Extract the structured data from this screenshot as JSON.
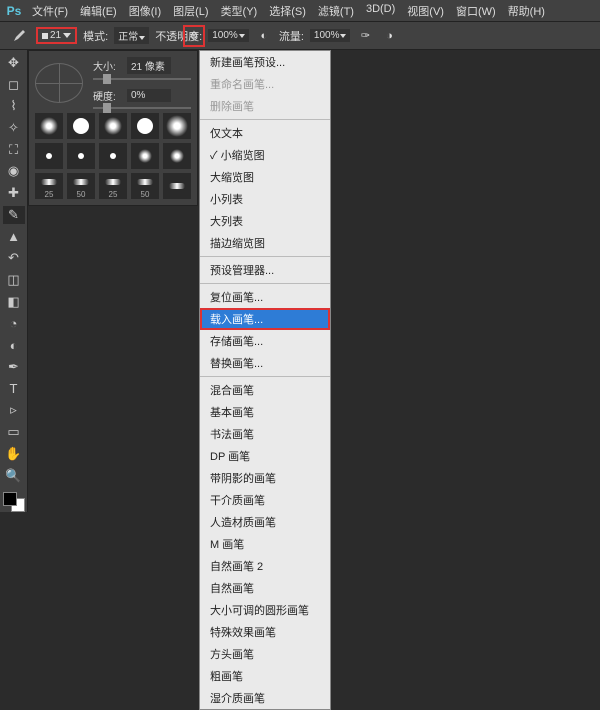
{
  "menubar": [
    "文件(F)",
    "编辑(E)",
    "图像(I)",
    "图层(L)",
    "类型(Y)",
    "选择(S)",
    "滤镜(T)",
    "3D(D)",
    "视图(V)",
    "窗口(W)",
    "帮助(H)"
  ],
  "optbar": {
    "brush_size": "21",
    "mode_label": "模式:",
    "mode_value": "正常",
    "opacity_label": "不透明度:",
    "opacity_value": "100%",
    "flow_label": "流量:",
    "flow_value": "100%"
  },
  "brush_panel": {
    "size_label": "大小:",
    "size_value": "21 像素",
    "hardness_label": "硬度:",
    "hardness_value": "0%",
    "presets": [
      "",
      "",
      "",
      "",
      "",
      "",
      "",
      "",
      "",
      "",
      "25",
      "50",
      "25",
      "50",
      ""
    ]
  },
  "context_menu": {
    "g1": [
      "新建画笔预设..."
    ],
    "g1d": [
      "重命名画笔...",
      "删除画笔"
    ],
    "g2": [
      "仅文本"
    ],
    "g2c": "小缩览图",
    "g2b": [
      "大缩览图",
      "小列表",
      "大列表",
      "描边缩览图"
    ],
    "g3": [
      "预设管理器..."
    ],
    "g4": [
      "复位画笔..."
    ],
    "g4hl": "载入画笔...",
    "g4b": [
      "存储画笔...",
      "替换画笔..."
    ],
    "g5": [
      "混合画笔",
      "基本画笔",
      "书法画笔",
      "DP 画笔",
      "带阴影的画笔",
      "干介质画笔",
      "人造材质画笔",
      "M 画笔",
      "自然画笔 2",
      "自然画笔",
      "大小可调的圆形画笔",
      "特殊效果画笔",
      "方头画笔",
      "粗画笔",
      "湿介质画笔"
    ]
  }
}
